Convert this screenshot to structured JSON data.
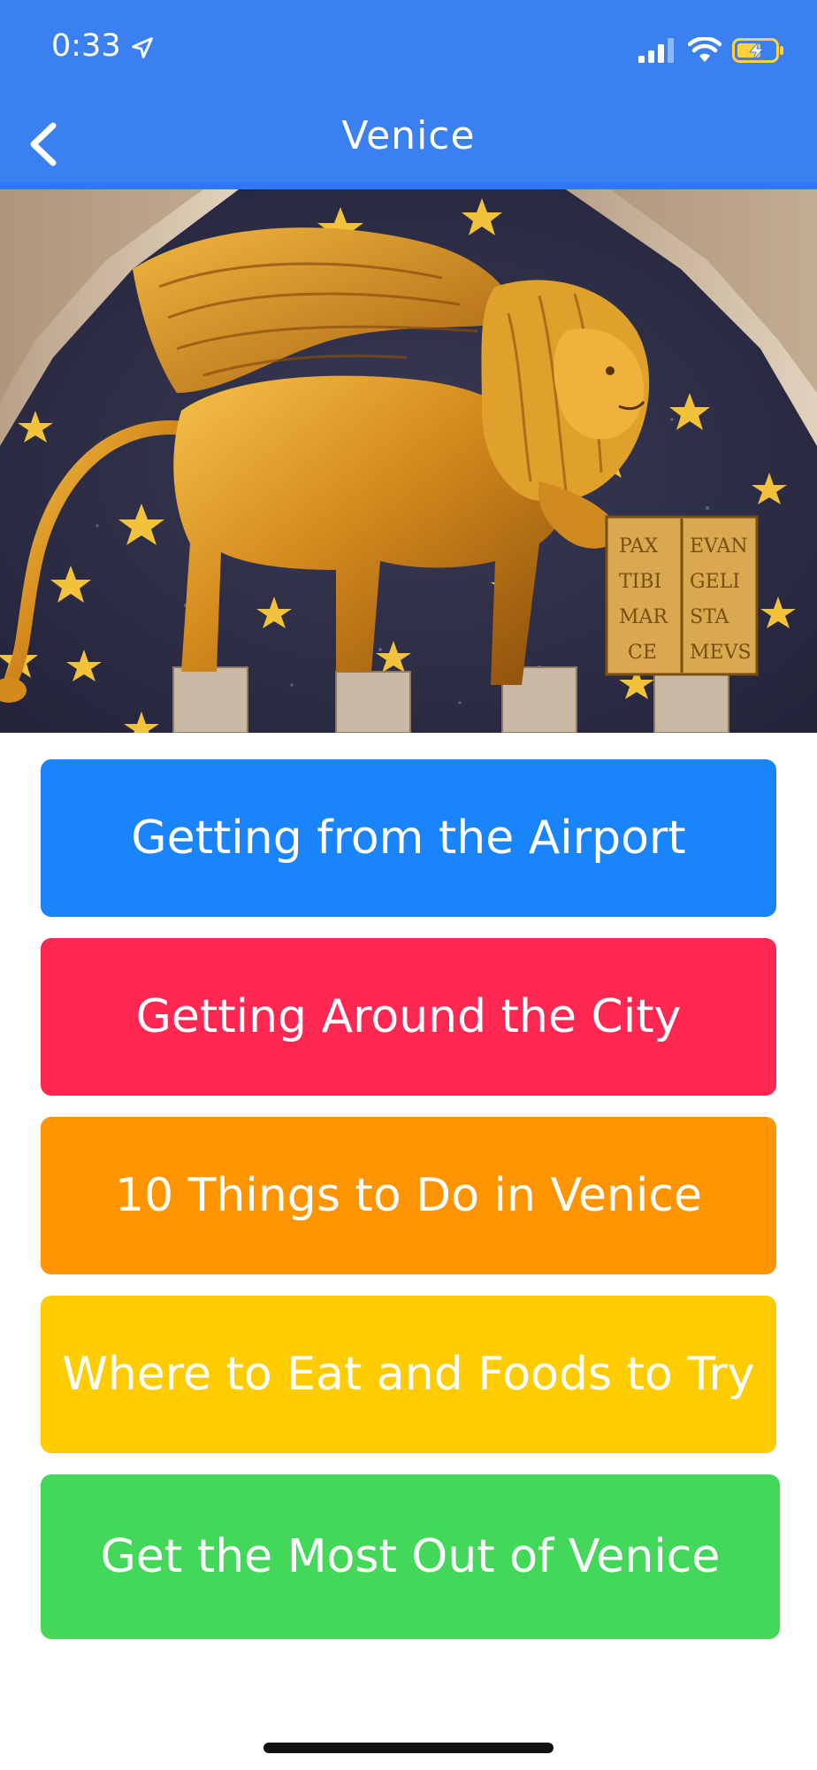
{
  "status_bar": {
    "time": "0:33",
    "location_icon": "location-arrow-icon",
    "signal_icon": "cellular-signal-icon",
    "wifi_icon": "wifi-icon",
    "battery_icon": "battery-charging-icon",
    "battery_color": "#ffd23c"
  },
  "nav": {
    "title": "Venice",
    "back_icon": "chevron-left-icon",
    "background": "#3a80f0"
  },
  "hero": {
    "subject": "winged-lion-image",
    "book_text": [
      "PAX",
      "EVAN",
      "TIBI",
      "GELI",
      "MAR",
      "STA",
      "CE",
      "MEVS"
    ]
  },
  "menu": [
    {
      "label": "Getting from the Airport",
      "color": "#1a84fb"
    },
    {
      "label": "Getting Around the City",
      "color": "#fd2751"
    },
    {
      "label": "10 Things to Do in Venice",
      "color": "#fe9400"
    },
    {
      "label": "Where to Eat and Foods to Try",
      "color": "#fecc00"
    },
    {
      "label": "Get the Most Out of Venice",
      "color": "#44d85b"
    }
  ]
}
